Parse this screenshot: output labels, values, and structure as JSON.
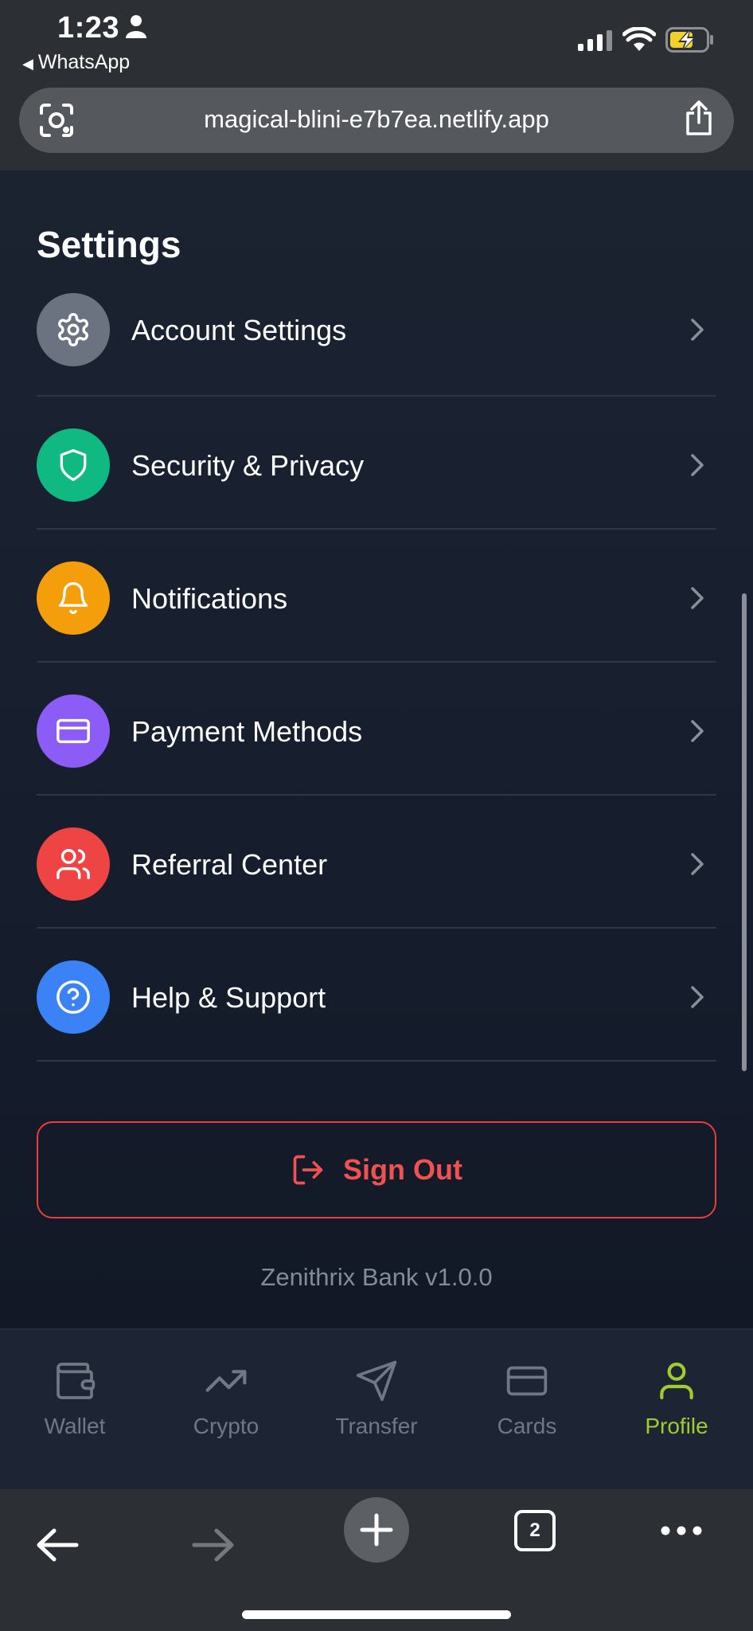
{
  "status_bar": {
    "time": "1:23",
    "back_app": "WhatsApp"
  },
  "browser": {
    "url": "magical-blini-e7b7ea.netlify.app",
    "tab_count": "2"
  },
  "settings": {
    "title": "Settings",
    "items": [
      {
        "label": "Account Settings",
        "icon": "gear-icon",
        "color": "#6b7280"
      },
      {
        "label": "Security & Privacy",
        "icon": "shield-icon",
        "color": "#10b981"
      },
      {
        "label": "Notifications",
        "icon": "bell-icon",
        "color": "#f59e0b"
      },
      {
        "label": "Payment Methods",
        "icon": "credit-card-icon",
        "color": "#8b5cf6"
      },
      {
        "label": "Referral Center",
        "icon": "users-icon",
        "color": "#ef4444"
      },
      {
        "label": "Help & Support",
        "icon": "help-circle-icon",
        "color": "#3b82f6"
      }
    ]
  },
  "sign_out": {
    "label": "Sign Out",
    "color": "#ef4444"
  },
  "footer": {
    "version": "Zenithrix Bank v1.0.0"
  },
  "nav": {
    "items": [
      {
        "label": "Wallet",
        "icon": "wallet-icon",
        "active": false
      },
      {
        "label": "Crypto",
        "icon": "trending-up-icon",
        "active": false
      },
      {
        "label": "Transfer",
        "icon": "send-icon",
        "active": false
      },
      {
        "label": "Cards",
        "icon": "credit-card-icon",
        "active": false
      },
      {
        "label": "Profile",
        "icon": "user-icon",
        "active": true
      }
    ],
    "active_color": "#9fcc2e"
  }
}
